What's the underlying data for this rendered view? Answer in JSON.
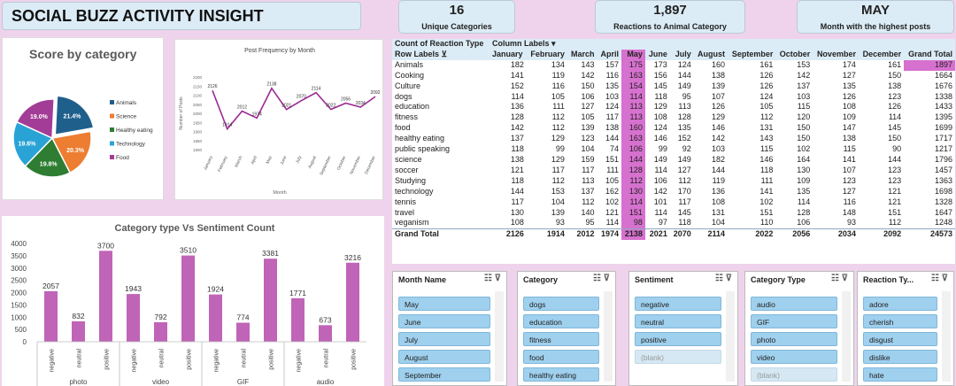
{
  "title": "SOCIAL BUZZ ACTIVITY INSIGHT",
  "kpis": [
    {
      "value": "16",
      "label": "Unique Categories"
    },
    {
      "value": "1,897",
      "label": "Reactions to Animal Category"
    },
    {
      "value": "MAY",
      "label": "Month with the highest posts"
    }
  ],
  "pie": {
    "title": "Score by category",
    "slices": [
      {
        "name": "Animals",
        "pct": 21.4,
        "label": "21.4%",
        "color": "#1f5f8b"
      },
      {
        "name": "Science",
        "pct": 20.3,
        "label": "20.3%",
        "color": "#ed7d31"
      },
      {
        "name": "Healthy eating",
        "pct": 19.8,
        "label": "19.8%",
        "color": "#2e7d32"
      },
      {
        "name": "Technology",
        "pct": 19.6,
        "label": "19.6%",
        "color": "#29a3d6"
      },
      {
        "name": "Food",
        "pct": 19.0,
        "label": "19.0%",
        "color": "#a23c96"
      }
    ]
  },
  "line": {
    "title": "Post Frequency by Month",
    "xlabel": "Month",
    "ylabel": "Number of Posts",
    "yticks": [
      "2200",
      "2150",
      "2100",
      "2050",
      "2000",
      "1950",
      "1900",
      "1850",
      "1800"
    ],
    "ylim": [
      1800,
      2200
    ],
    "months": [
      "January",
      "February",
      "March",
      "April",
      "May",
      "June",
      "July",
      "August",
      "September",
      "October",
      "November",
      "December"
    ],
    "values": [
      2126,
      1914,
      2012,
      1974,
      2138,
      2021,
      2070,
      2114,
      2022,
      2056,
      2034,
      2092
    ],
    "labels": [
      "2126",
      "1914",
      "2012",
      "1974",
      "2138",
      "2021",
      "2070",
      "2114",
      "2022",
      "2056",
      "2034",
      "2092"
    ]
  },
  "chart_data": {
    "type": "bar",
    "title": "Category type Vs Sentiment Count",
    "groups": [
      "photo",
      "video",
      "GIF",
      "audio"
    ],
    "categories": [
      "negative",
      "neutral",
      "positive"
    ],
    "values": [
      [
        2057,
        832,
        3700
      ],
      [
        1943,
        792,
        3510
      ],
      [
        1924,
        774,
        3381
      ],
      [
        1771,
        673,
        3216
      ]
    ],
    "yticks": [
      "4000",
      "3500",
      "3000",
      "2500",
      "2000",
      "1500",
      "1000",
      "500",
      "0"
    ],
    "ylim": [
      0,
      4000
    ],
    "color": "#c064b8"
  },
  "pivot": {
    "corner": "Count of Reaction Type",
    "col_labels": "Column Labels",
    "row_labels": "Row Labels",
    "months": [
      "January",
      "February",
      "March",
      "April",
      "May",
      "June",
      "July",
      "August",
      "September",
      "October",
      "November",
      "December"
    ],
    "grand_total_label": "Grand Total",
    "rows": [
      [
        "Animals",
        "182",
        "134",
        "143",
        "157",
        "175",
        "173",
        "124",
        "160",
        "161",
        "153",
        "174",
        "161",
        "1897"
      ],
      [
        "Cooking",
        "141",
        "119",
        "142",
        "116",
        "163",
        "156",
        "144",
        "138",
        "126",
        "142",
        "127",
        "150",
        "1664"
      ],
      [
        "Culture",
        "152",
        "116",
        "150",
        "135",
        "154",
        "145",
        "149",
        "139",
        "126",
        "137",
        "135",
        "138",
        "1676"
      ],
      [
        "dogs",
        "114",
        "105",
        "106",
        "103",
        "114",
        "118",
        "95",
        "107",
        "124",
        "103",
        "126",
        "123",
        "1338"
      ],
      [
        "education",
        "136",
        "111",
        "127",
        "124",
        "113",
        "129",
        "113",
        "126",
        "105",
        "115",
        "108",
        "126",
        "1433"
      ],
      [
        "fitness",
        "128",
        "112",
        "105",
        "117",
        "113",
        "108",
        "128",
        "129",
        "112",
        "120",
        "109",
        "114",
        "1395"
      ],
      [
        "food",
        "142",
        "112",
        "139",
        "138",
        "160",
        "124",
        "135",
        "146",
        "131",
        "150",
        "147",
        "145",
        "1699"
      ],
      [
        "healthy eating",
        "137",
        "129",
        "123",
        "144",
        "163",
        "146",
        "152",
        "142",
        "143",
        "150",
        "138",
        "150",
        "1717"
      ],
      [
        "public speaking",
        "118",
        "99",
        "104",
        "74",
        "106",
        "99",
        "92",
        "103",
        "115",
        "102",
        "115",
        "90",
        "1217"
      ],
      [
        "science",
        "138",
        "129",
        "159",
        "151",
        "144",
        "149",
        "149",
        "182",
        "146",
        "164",
        "141",
        "144",
        "1796"
      ],
      [
        "soccer",
        "121",
        "117",
        "117",
        "111",
        "128",
        "114",
        "127",
        "144",
        "118",
        "130",
        "107",
        "123",
        "1457"
      ],
      [
        "Studying",
        "118",
        "112",
        "113",
        "105",
        "112",
        "106",
        "112",
        "119",
        "111",
        "109",
        "123",
        "123",
        "1363"
      ],
      [
        "technology",
        "144",
        "153",
        "137",
        "162",
        "130",
        "142",
        "170",
        "136",
        "141",
        "135",
        "127",
        "121",
        "1698"
      ],
      [
        "tennis",
        "117",
        "104",
        "112",
        "102",
        "114",
        "101",
        "117",
        "108",
        "102",
        "114",
        "116",
        "121",
        "1328"
      ],
      [
        "travel",
        "130",
        "139",
        "140",
        "121",
        "151",
        "114",
        "145",
        "131",
        "151",
        "128",
        "148",
        "151",
        "1647"
      ],
      [
        "veganism",
        "108",
        "93",
        "95",
        "114",
        "98",
        "97",
        "118",
        "104",
        "110",
        "106",
        "93",
        "112",
        "1248"
      ]
    ],
    "totals": [
      "Grand Total",
      "2126",
      "1914",
      "2012",
      "1974",
      "2138",
      "2021",
      "2070",
      "2114",
      "2022",
      "2056",
      "2034",
      "2092",
      "24573"
    ]
  },
  "slicers": [
    {
      "title": "Month Name",
      "items": [
        "May",
        "June",
        "July",
        "August",
        "September"
      ]
    },
    {
      "title": "Category",
      "items": [
        "dogs",
        "education",
        "fitness",
        "food",
        "healthy eating"
      ]
    },
    {
      "title": "Sentiment",
      "items": [
        "negative",
        "neutral",
        "positive",
        "(blank)"
      ]
    },
    {
      "title": "Category Type",
      "items": [
        "audio",
        "GIF",
        "photo",
        "video",
        "(blank)"
      ]
    },
    {
      "title": "Reaction Ty...",
      "items": [
        "adore",
        "cherish",
        "disgust",
        "dislike",
        "hate"
      ]
    }
  ]
}
